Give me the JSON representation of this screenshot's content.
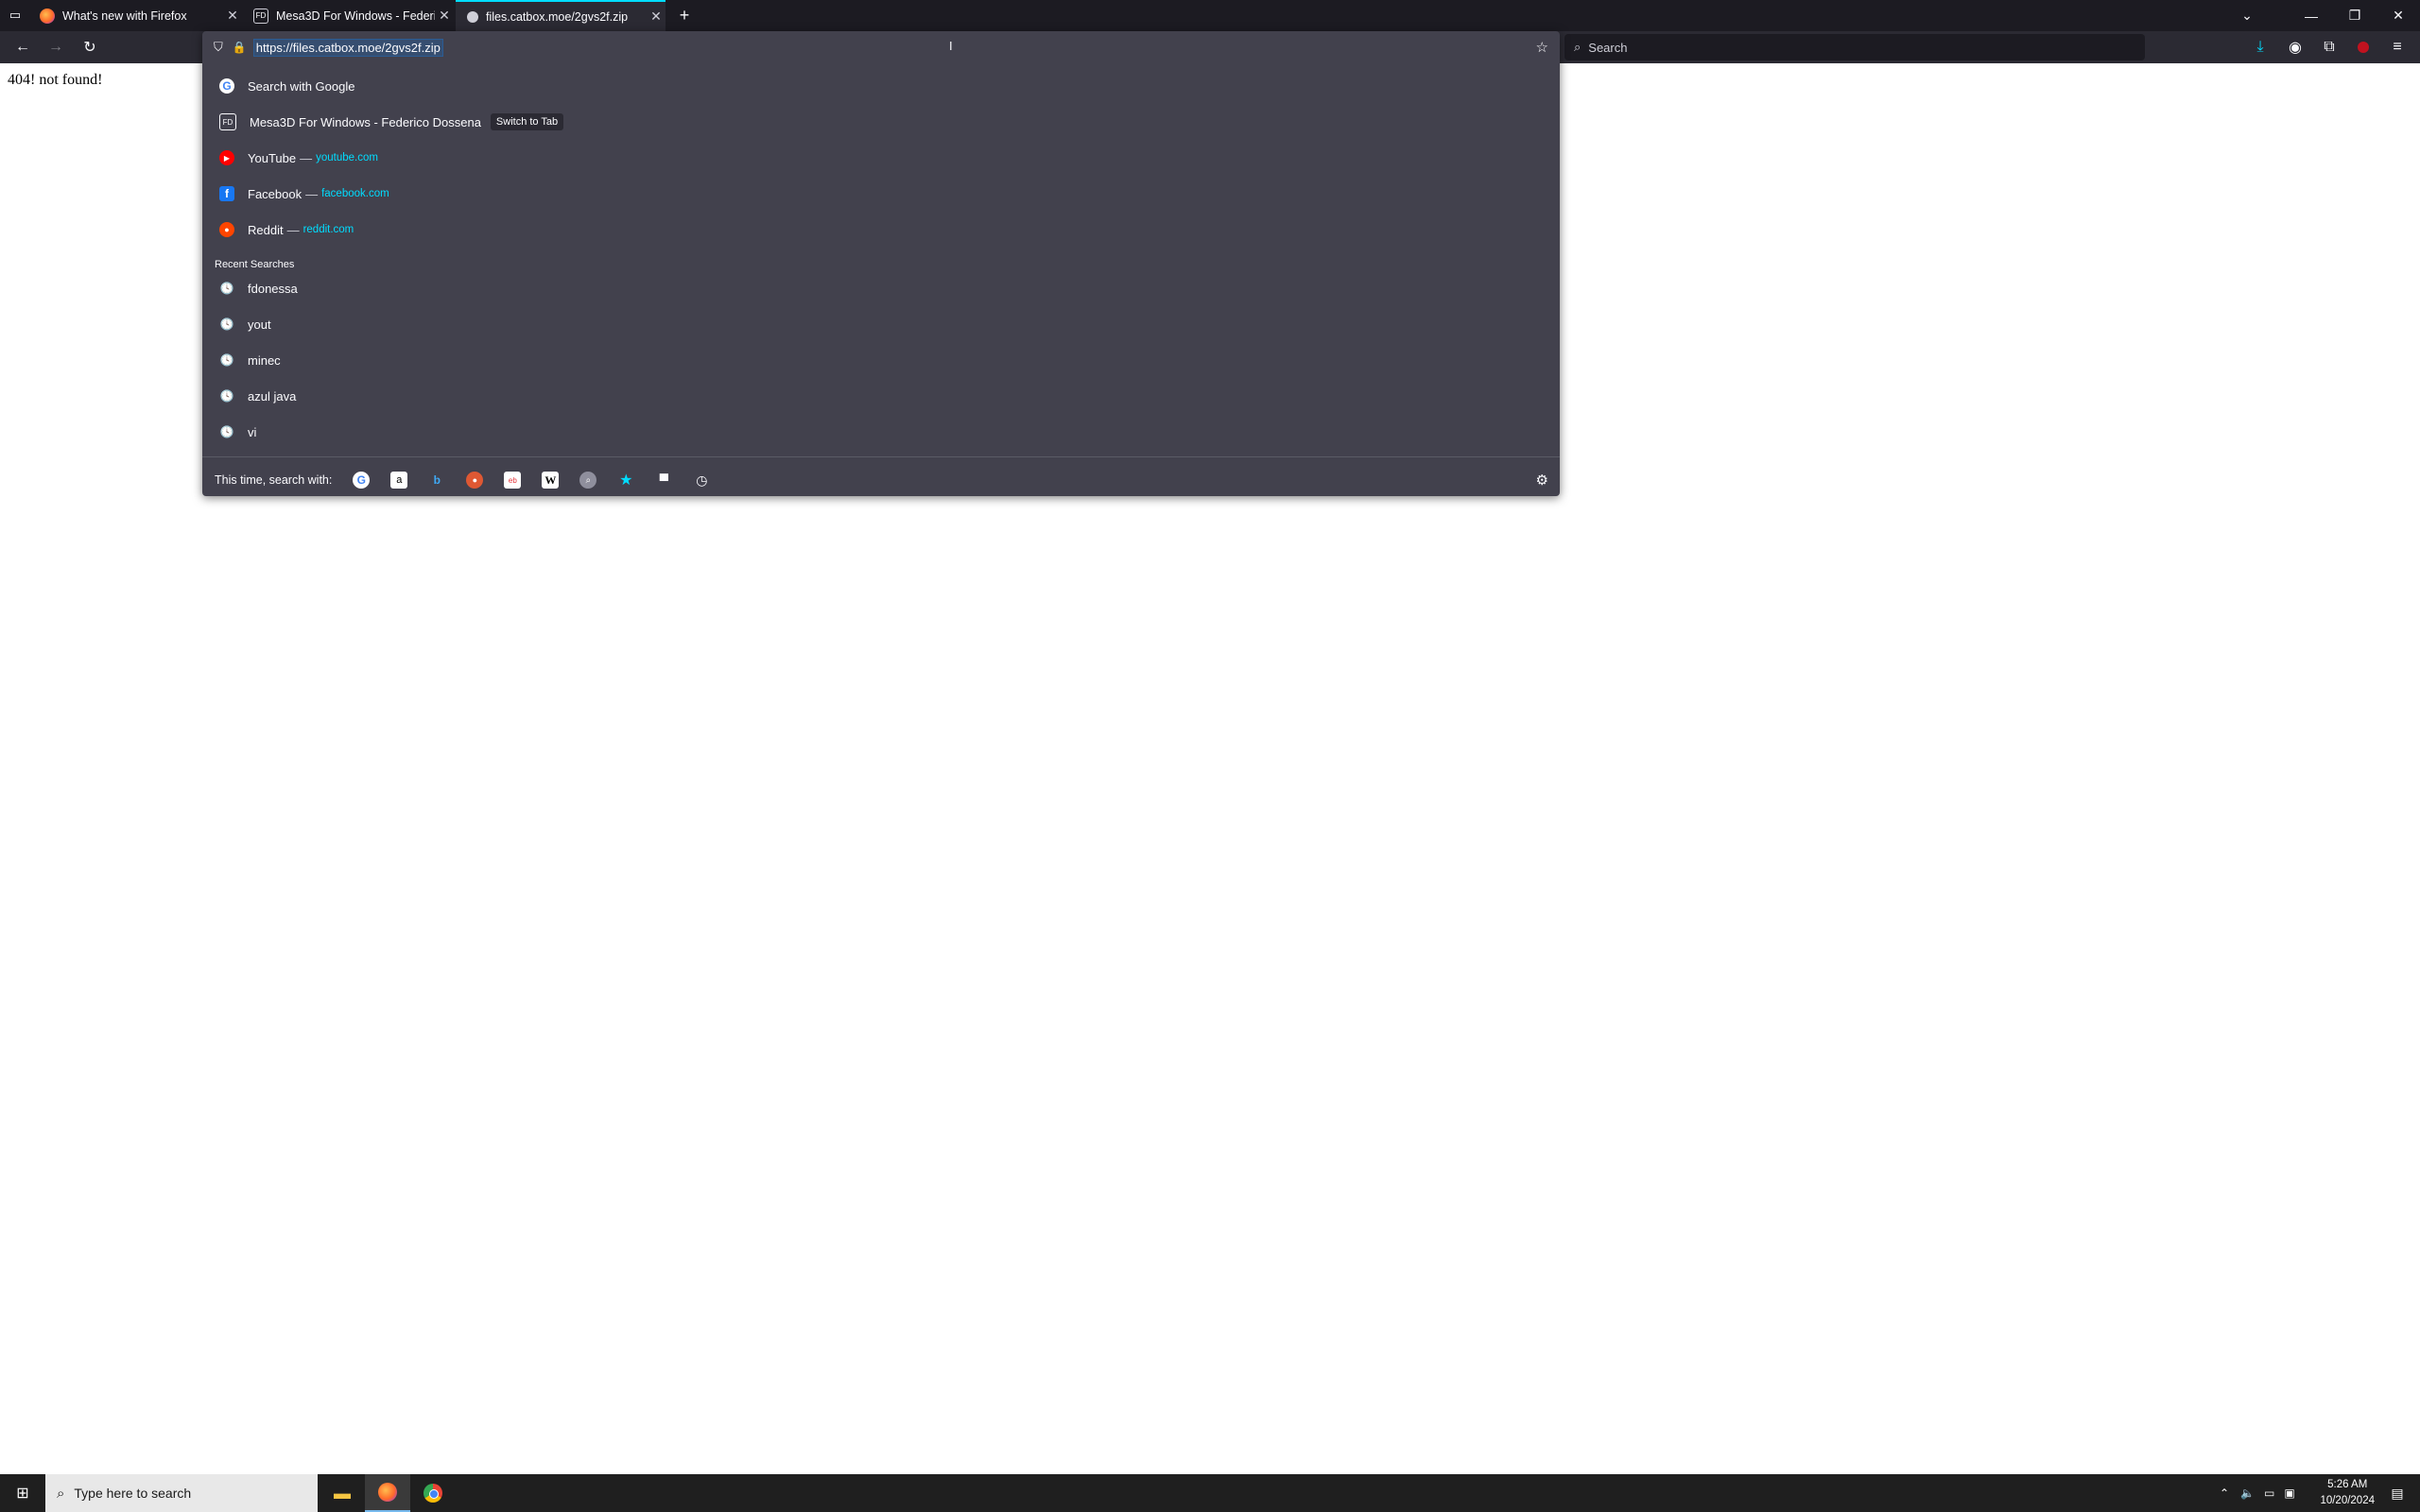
{
  "browser": {
    "tabs": [
      {
        "title": "What's new with Firefox",
        "active": false
      },
      {
        "title": "Mesa3D For Windows - Federico",
        "active": false
      },
      {
        "title": "files.catbox.moe/2gvs2f.zip",
        "active": true
      }
    ],
    "new_tab_symbol": "+",
    "search_placeholder": "Search"
  },
  "urlbar": {
    "url": "https://files.catbox.moe/2gvs2f.zip"
  },
  "page": {
    "message": "404! not found!"
  },
  "dropdown": {
    "search_with": "Search with Google",
    "switch_tab": {
      "title": "Mesa3D For Windows - Federico Dossena",
      "button": "Switch to Tab"
    },
    "shortcuts": [
      {
        "name": "YouTube",
        "sep": "—",
        "domain": "youtube.com"
      },
      {
        "name": "Facebook",
        "sep": "—",
        "domain": "facebook.com"
      },
      {
        "name": "Reddit",
        "sep": "—",
        "domain": "reddit.com"
      }
    ],
    "recent_label": "Recent Searches",
    "recent": [
      "fdonessa",
      "yout",
      "minec",
      "azul java",
      "vi"
    ],
    "footer_label": "This time, search with:"
  },
  "taskbar": {
    "search_placeholder": "Type here to search",
    "time": "5:26 AM",
    "date": "10/20/2024"
  },
  "colors": {
    "accent": "#00ddff",
    "popup_bg": "#42414d",
    "toolbar_bg": "#2b2a33"
  }
}
